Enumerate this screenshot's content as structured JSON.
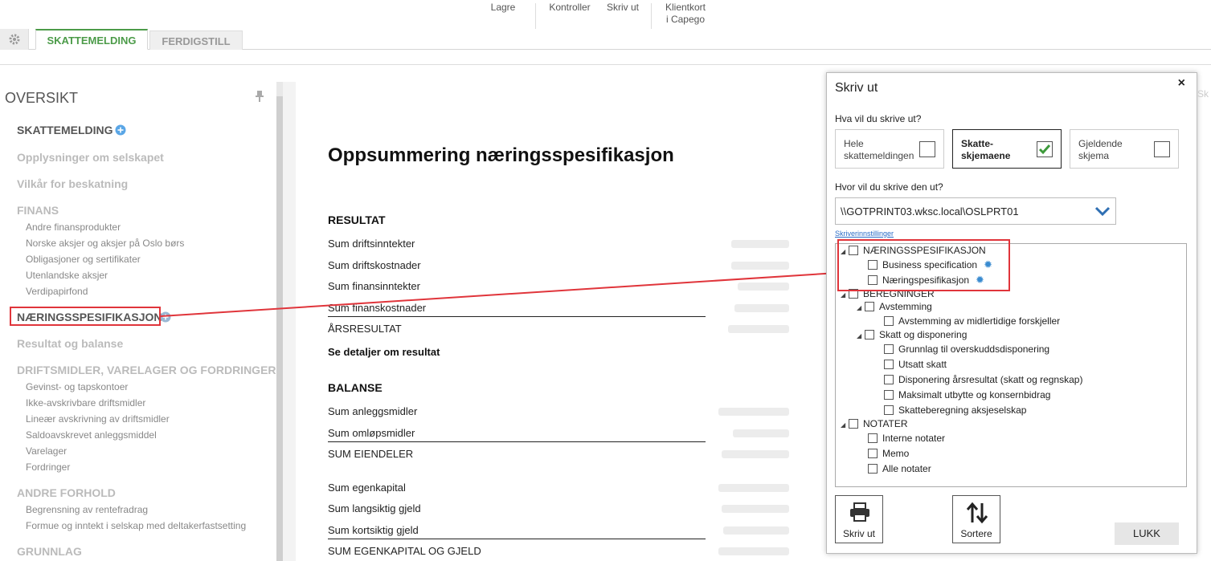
{
  "ribbon": {
    "save_label": "Lagre",
    "check_label": "Kontroller",
    "print_label": "Skriv ut",
    "client_card_line1": "Klientkort",
    "client_card_line2": "i Capego"
  },
  "tabs": [
    {
      "label": "SKATTEMELDING",
      "active": true
    },
    {
      "label": "FERDIGSTILL",
      "active": false
    }
  ],
  "sidebar": {
    "title": "OVERSIKT",
    "items": [
      {
        "label": "SKATTEMELDING"
      },
      {
        "label": "Opplysninger om selskapet"
      },
      {
        "label": "Vilkår for beskatning"
      },
      {
        "label": "FINANS"
      },
      {
        "label": "Andre finansprodukter"
      },
      {
        "label": "Norske aksjer og aksjer på Oslo børs"
      },
      {
        "label": "Obligasjoner og sertifikater"
      },
      {
        "label": "Utenlandske aksjer"
      },
      {
        "label": "Verdipapirfond"
      },
      {
        "label": "NÆRINGSSPESIFIKASJON"
      },
      {
        "label": "Resultat og balanse"
      },
      {
        "label": "DRIFTSMIDLER, VARELAGER OG FORDRINGER"
      },
      {
        "label": "Gevinst- og tapskontoer"
      },
      {
        "label": "Ikke-avskrivbare driftsmidler"
      },
      {
        "label": "Lineær avskrivning av driftsmidler"
      },
      {
        "label": "Saldoavskrevet anleggsmiddel"
      },
      {
        "label": "Varelager"
      },
      {
        "label": "Fordringer"
      },
      {
        "label": "ANDRE FORHOLD"
      },
      {
        "label": "Begrensning av rentefradrag"
      },
      {
        "label": "Formue og inntekt i selskap med deltakerfastsetting"
      },
      {
        "label": "GRUNNLAG"
      }
    ]
  },
  "doc": {
    "title": "Oppsummering næringsspesifikasjon",
    "resultat_heading": "RESULTAT",
    "resultat_rows": [
      "Sum driftsinntekter",
      "Sum driftskostnader",
      "Sum finansinntekter",
      "Sum finanskostnader",
      "ÅRSRESULTAT"
    ],
    "details_link": "Se detaljer om resultat",
    "balanse_heading": "BALANSE",
    "balanse_rows": [
      "Sum anleggsmidler",
      "Sum omløpsmidler",
      "SUM EIENDELER",
      "Sum egenkapital",
      "Sum langsiktig gjeld",
      "Sum kortsiktig gjeld",
      "SUM EGENKAPITAL OG GJELD"
    ]
  },
  "dialog": {
    "title": "Skriv ut",
    "close": "×",
    "question_what": "Hva vil du skrive ut?",
    "options": [
      {
        "line1": "Hele",
        "line2": "skattemeldingen",
        "checked": false
      },
      {
        "line1": "Skatte-",
        "line2": "skjemaene",
        "checked": true
      },
      {
        "line1": "Gjeldende",
        "line2": "skjema",
        "checked": false
      }
    ],
    "question_where": "Hvor vil du skrive den ut?",
    "printer": "\\\\GOTPRINT03.wksc.local\\OSLPRT01",
    "printer_settings_link": "Skriverinnstillinger",
    "tree": [
      "NÆRINGSSPESIFIKASJON",
      "Business specification",
      "Næringspesifikasjon",
      "BEREGNINGER",
      "Avstemming",
      "Avstemming av midlertidige forskjeller",
      "Skatt og disponering",
      "Grunnlag til overskuddsdisponering",
      "Utsatt skatt",
      "Disponering årsresultat (skatt og regnskap)",
      "Maksimalt utbytte og konsernbidrag",
      "Skatteberegning aksjeselskap",
      "NOTATER",
      "Interne notater",
      "Memo",
      "Alle notater"
    ],
    "print_button": "Skriv ut",
    "sort_button": "Sortere",
    "close_button": "LUKK"
  },
  "colors": {
    "accent_green": "#4c9b49",
    "highlight_red": "#e0353b",
    "link_blue": "#2a6cc7"
  }
}
